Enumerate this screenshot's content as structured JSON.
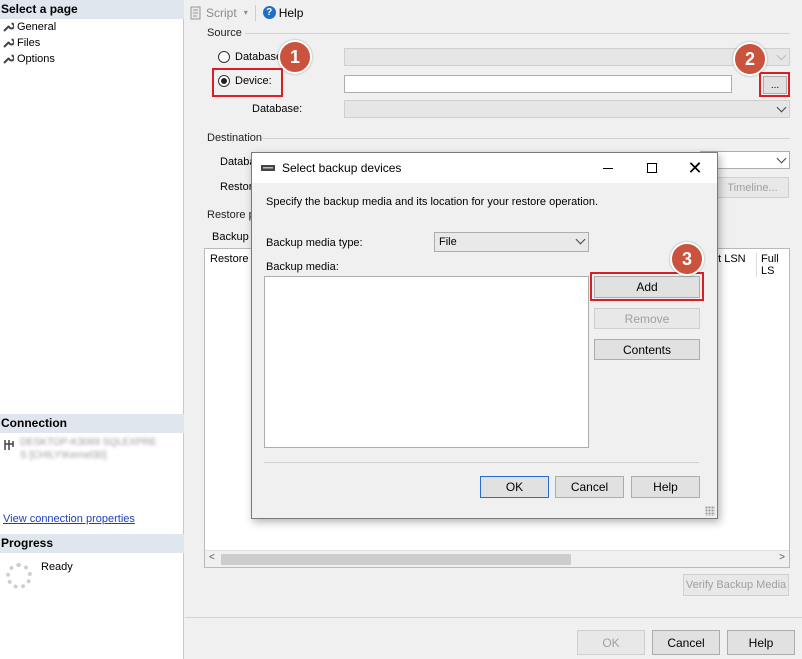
{
  "left_pane": {
    "select_page_header": "Select a page",
    "pages": [
      "General",
      "Files",
      "Options"
    ],
    "connection_header": "Connection",
    "connection_lines": [
      "DESKTOP-K3069 SQLEXPRE",
      "S [CHILY\\Kernel30]"
    ],
    "view_connection_link": "View connection properties",
    "progress_header": "Progress",
    "progress_status": "Ready"
  },
  "toolbar": {
    "script_label": "Script",
    "help_label": "Help"
  },
  "source": {
    "group_label": "Source",
    "database_radio_label": "Database:",
    "device_radio_label": "Device:",
    "database_label": "Database:",
    "browse_button_label": "...",
    "selected_option": "Device"
  },
  "destination": {
    "group_label": "Destination",
    "database_label_partial": "Databa",
    "restore_to_label_partial": "Restore",
    "timeline_button_label": "Timeline..."
  },
  "restore_plan": {
    "group_label_partial": "Restore pl",
    "backup_sets_label_partial": "Backup s",
    "columns": [
      "Restore",
      "nt LSN",
      "Full LS"
    ]
  },
  "verify_button_label": "Verify Backup Media",
  "bottom_buttons": {
    "ok": "OK",
    "cancel": "Cancel",
    "help": "Help"
  },
  "dialog": {
    "title": "Select backup devices",
    "instruction": "Specify the backup media and its location for your restore operation.",
    "media_type_label": "Backup media type:",
    "media_type_value": "File",
    "media_list_label": "Backup media:",
    "add_button_label": "Add",
    "remove_button_label": "Remove",
    "contents_button_label": "Contents",
    "ok_label": "OK",
    "cancel_label": "Cancel",
    "help_label": "Help"
  },
  "annotations": {
    "badge1": "1",
    "badge2": "2",
    "badge3": "3"
  },
  "colors": {
    "highlight": "#d91e24",
    "badge": "#c9533d",
    "link": "#1f3fbf",
    "section_header": "#dfe6ee"
  },
  "icons": [
    "wrench-icon",
    "script-icon",
    "help-icon",
    "connection-icon",
    "progress-spinner-icon",
    "tape-drive-icon",
    "minimize-icon",
    "maximize-icon",
    "close-icon",
    "chevron-down-icon"
  ]
}
